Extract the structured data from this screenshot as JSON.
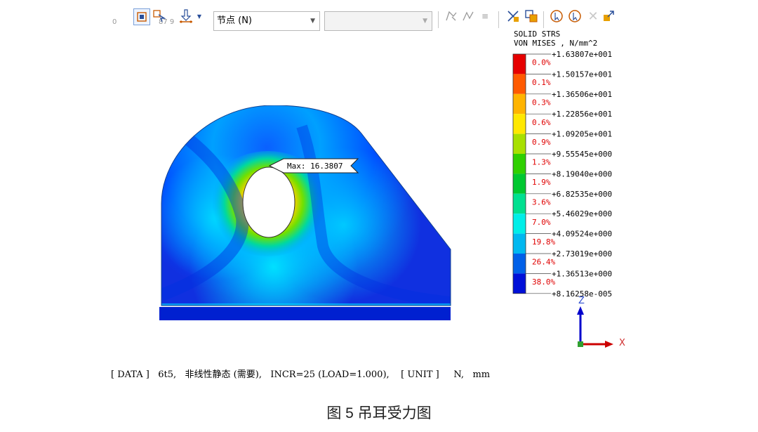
{
  "toolbar": {
    "ruler_left": "0",
    "ruler_mid": "87 9",
    "node_select": "节点 (N)",
    "empty_select": ""
  },
  "legend": {
    "title_line1": "SOLID STRS",
    "title_line2": "VON MISES , N/mm^2",
    "levels": [
      "+1.63807e+001",
      "+1.50157e+001",
      "+1.36506e+001",
      "+1.22856e+001",
      "+1.09205e+001",
      "+9.55545e+000",
      "+8.19040e+000",
      "+6.82535e+000",
      "+5.46029e+000",
      "+4.09524e+000",
      "+2.73019e+000",
      "+1.36513e+000",
      "+8.16258e-005"
    ],
    "percents": [
      "0.0%",
      "0.1%",
      "0.3%",
      "0.6%",
      "0.9%",
      "1.3%",
      "1.9%",
      "3.6%",
      "7.0%",
      "19.8%",
      "26.4%",
      "38.0%"
    ],
    "colors": [
      "#e60000",
      "#ff5a00",
      "#ffb400",
      "#ffe800",
      "#a8e000",
      "#2fd000",
      "#00c830",
      "#00e090",
      "#00eee8",
      "#00b8f0",
      "#0060e8",
      "#0010d8"
    ]
  },
  "model": {
    "max_label": "Max: 16.3807"
  },
  "axes": {
    "z_label": "Z",
    "x_label": "X"
  },
  "status_bar": {
    "text": "[ DATA ]   6t5,   非线性静态 (需要),   INCR=25 (LOAD=1.000),    [ UNIT ]     N,   mm"
  },
  "caption": "图 5 吊耳受力图"
}
